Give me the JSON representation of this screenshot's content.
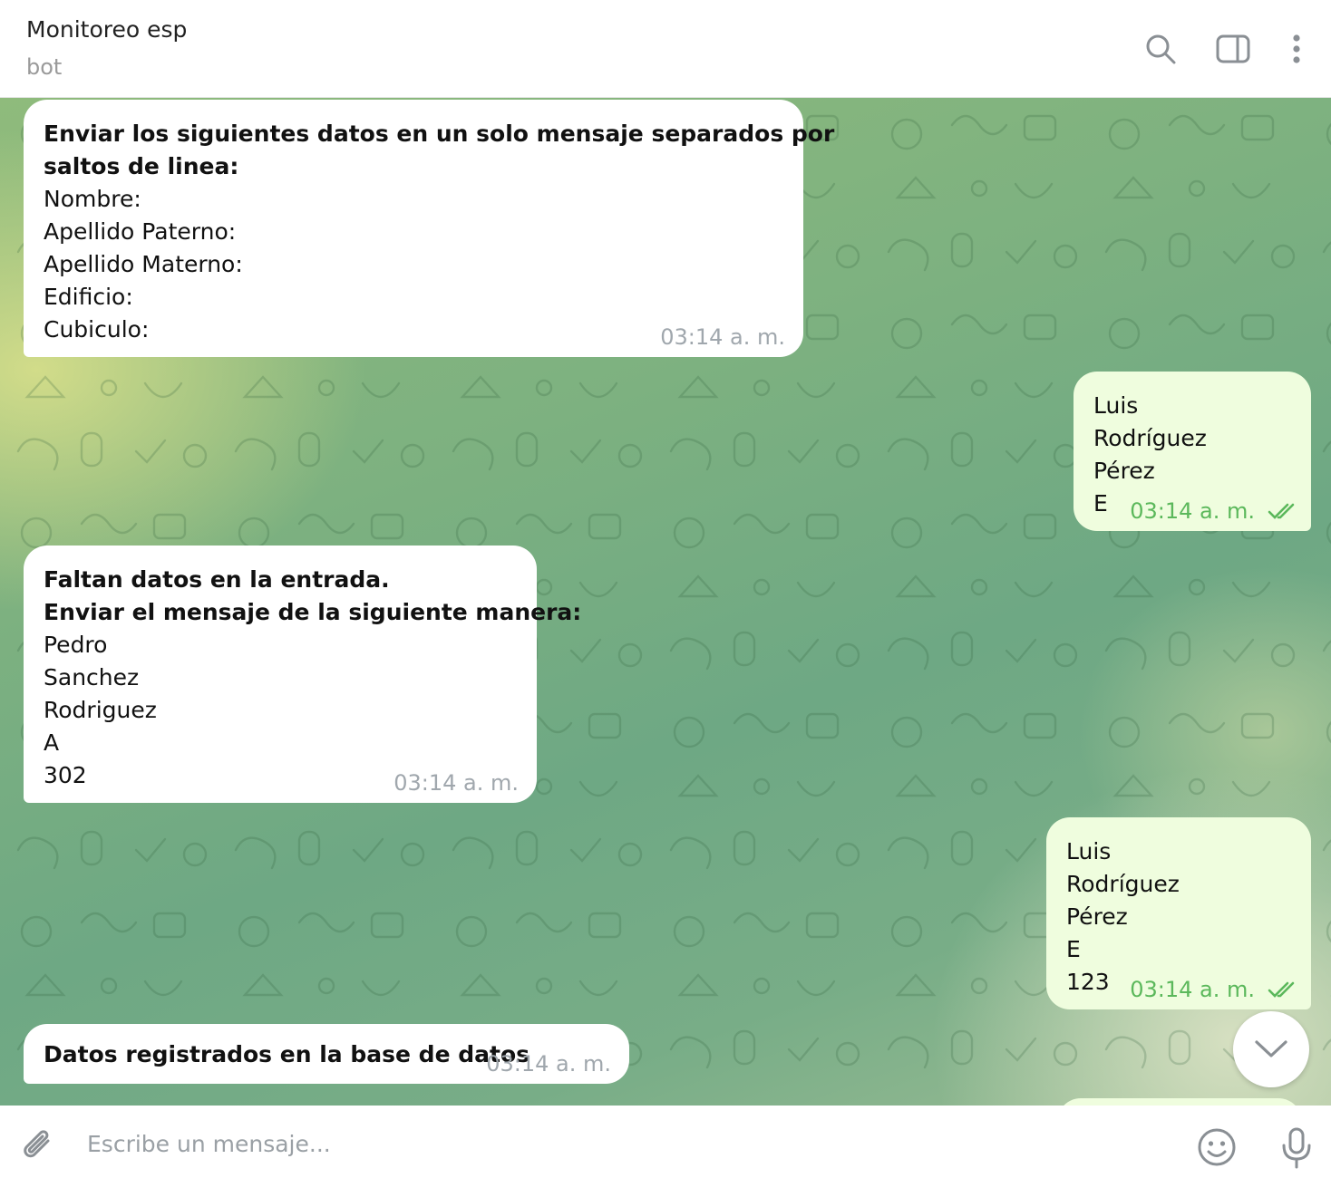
{
  "header": {
    "title": "Monitoreo esp",
    "subtitle": "bot",
    "icons": [
      "search-icon",
      "sidebar-toggle-icon",
      "more-vertical-icon"
    ]
  },
  "messages": [
    {
      "direction": "incoming",
      "lines": [
        {
          "text": "Enviar los siguientes datos en un solo mensaje separados por",
          "bold": true
        },
        {
          "text": "saltos de linea:",
          "bold": true
        },
        {
          "text": "Nombre:",
          "bold": false
        },
        {
          "text": "Apellido Paterno:",
          "bold": false
        },
        {
          "text": "Apellido Materno:",
          "bold": false
        },
        {
          "text": "Edificio:",
          "bold": false
        },
        {
          "text": "Cubiculo:",
          "bold": false
        }
      ],
      "time": "03:14 a. m."
    },
    {
      "direction": "outgoing",
      "lines": [
        {
          "text": "Luis",
          "bold": false
        },
        {
          "text": "Rodríguez",
          "bold": false
        },
        {
          "text": "Pérez",
          "bold": false
        },
        {
          "text": "E",
          "bold": false
        }
      ],
      "time": "03:14 a. m.",
      "status": "read"
    },
    {
      "direction": "incoming",
      "lines": [
        {
          "text": "Faltan datos en la entrada.",
          "bold": true
        },
        {
          "text": "Enviar el mensaje de la siguiente manera:",
          "bold": true
        },
        {
          "text": "Pedro",
          "bold": false
        },
        {
          "text": "Sanchez",
          "bold": false
        },
        {
          "text": "Rodriguez",
          "bold": false
        },
        {
          "text": "A",
          "bold": false
        },
        {
          "text": "302",
          "bold": false
        }
      ],
      "time": "03:14 a. m."
    },
    {
      "direction": "outgoing",
      "lines": [
        {
          "text": "Luis",
          "bold": false
        },
        {
          "text": "Rodríguez",
          "bold": false
        },
        {
          "text": "Pérez",
          "bold": false
        },
        {
          "text": "E",
          "bold": false
        },
        {
          "text": "123",
          "bold": false
        }
      ],
      "time": "03:14 a. m.",
      "status": "read"
    },
    {
      "direction": "incoming",
      "lines": [
        {
          "text": "Datos registrados en la base de datos",
          "bold": true
        }
      ],
      "time": "03:14 a. m."
    }
  ],
  "composer": {
    "placeholder": "Escribe un mensaje...",
    "icons": [
      "attach-icon",
      "emoji-icon",
      "microphone-icon"
    ]
  },
  "colors": {
    "incoming_bubble": "#ffffff",
    "outgoing_bubble": "#effdde",
    "outgoing_time": "#5bb85b",
    "incoming_time": "#a0a7ad",
    "icon_gray": "#8a8f94"
  }
}
